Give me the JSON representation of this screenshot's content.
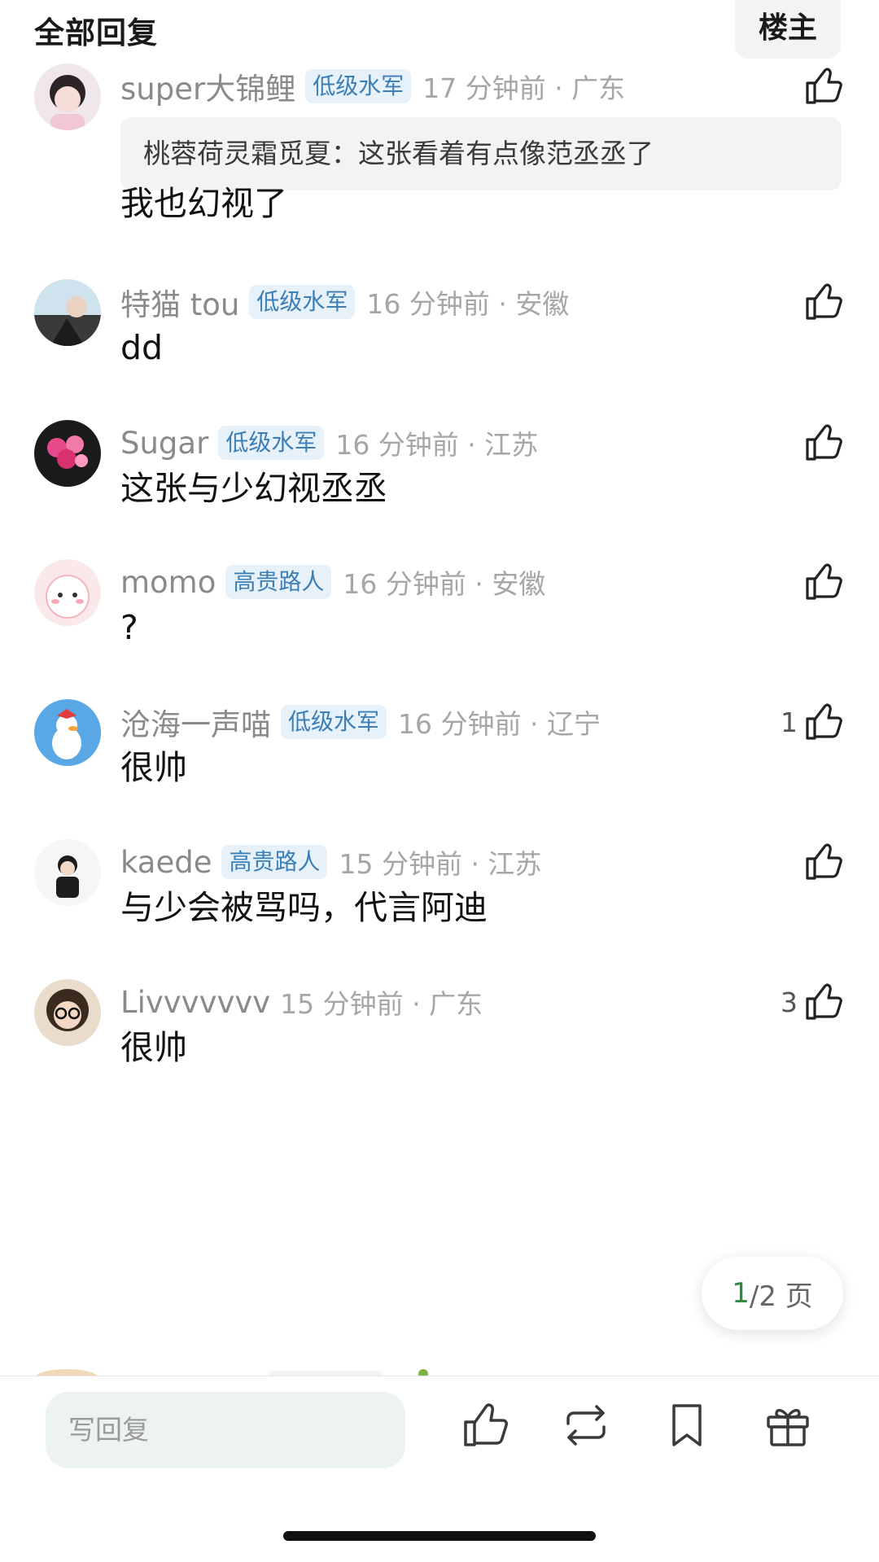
{
  "header": {
    "title": "全部回复",
    "op_button_label": "楼主"
  },
  "comments": [
    {
      "username": "super大锦鲤",
      "badge": "低级水军",
      "time_location": "17 分钟前 · 广东",
      "quote": "桃蓉荷灵霜觅夏：这张看着有点像范丞丞了",
      "text": "我也幻视了",
      "likes": ""
    },
    {
      "username": "特猫 tou",
      "badge": "低级水军",
      "time_location": "16 分钟前 · 安徽",
      "text": "dd",
      "likes": ""
    },
    {
      "username": "Sugar",
      "badge": "低级水军",
      "time_location": "16 分钟前 · 江苏",
      "text": "这张与少幻视丞丞",
      "likes": ""
    },
    {
      "username": "momo",
      "badge": "高贵路人",
      "time_location": "16 分钟前 · 安徽",
      "text": "?",
      "likes": ""
    },
    {
      "username": "沧海一声喵",
      "badge": "低级水军",
      "time_location": "16 分钟前 · 辽宁",
      "text": "很帅",
      "likes": "1"
    },
    {
      "username": "kaede",
      "badge": "高贵路人",
      "time_location": "15 分钟前 · 江苏",
      "text": "与少会被骂吗，代言阿迪",
      "likes": ""
    },
    {
      "username": "Livvvvvvv",
      "badge": "",
      "time_location": "15 分钟前 · 广东",
      "text": "很帅",
      "likes": "3"
    }
  ],
  "pagination": {
    "current": "1",
    "total_label": "/2 页"
  },
  "bottom_bar": {
    "reply_placeholder": "写回复",
    "icons": [
      "thumbs-up-icon",
      "repost-icon",
      "bookmark-icon",
      "gift-icon"
    ]
  },
  "colors": {
    "badge_text": "#3c7fb6",
    "badge_bg": "#e7f1fa",
    "page_current": "#2e8b3d",
    "reply_bg": "#edf3ef"
  }
}
